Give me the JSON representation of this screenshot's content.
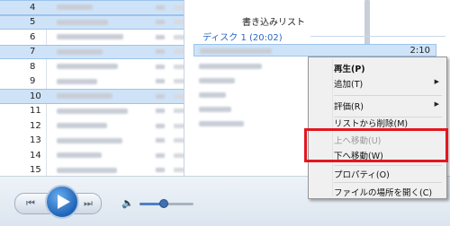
{
  "tracklist": {
    "rows": [
      {
        "num": "4",
        "selected": true
      },
      {
        "num": "5",
        "selected": true
      },
      {
        "num": "6",
        "selected": false
      },
      {
        "num": "7",
        "selected": true
      },
      {
        "num": "8",
        "selected": false
      },
      {
        "num": "9",
        "selected": false
      },
      {
        "num": "10",
        "selected": true
      },
      {
        "num": "11",
        "selected": false
      },
      {
        "num": "12",
        "selected": false
      },
      {
        "num": "13",
        "selected": false
      },
      {
        "num": "14",
        "selected": false
      },
      {
        "num": "15",
        "selected": false
      }
    ]
  },
  "burn": {
    "header": "書き込みリスト",
    "disc": "ディスク 1 (20:02)",
    "selected_duration": "2:10"
  },
  "context_menu": {
    "items": [
      {
        "label": "再生(P)",
        "bold": true,
        "disabled": false,
        "submenu": false
      },
      {
        "label": "追加(T)",
        "bold": false,
        "disabled": false,
        "submenu": true
      },
      {
        "label": "評価(R)",
        "bold": false,
        "disabled": false,
        "submenu": true
      },
      {
        "label": "リストから削除(M)",
        "bold": false,
        "disabled": false,
        "submenu": false
      },
      {
        "label": "上へ移動(U)",
        "bold": false,
        "disabled": true,
        "submenu": false
      },
      {
        "label": "下へ移動(W)",
        "bold": false,
        "disabled": false,
        "submenu": false
      },
      {
        "label": "プロパティ(O)",
        "bold": false,
        "disabled": false,
        "submenu": false
      },
      {
        "label": "ファイルの場所を開く(C)",
        "bold": false,
        "disabled": false,
        "submenu": false
      }
    ]
  },
  "player": {
    "volume_level": 0.45
  },
  "icons": {
    "play": "play-icon",
    "prev": "previous-icon",
    "next": "next-icon",
    "volume": "speaker-icon",
    "submenu": "triangle-right-icon"
  },
  "colors": {
    "selection": "#cfe3f8",
    "highlight_box": "#e3161e",
    "accent": "#2a66c6"
  }
}
